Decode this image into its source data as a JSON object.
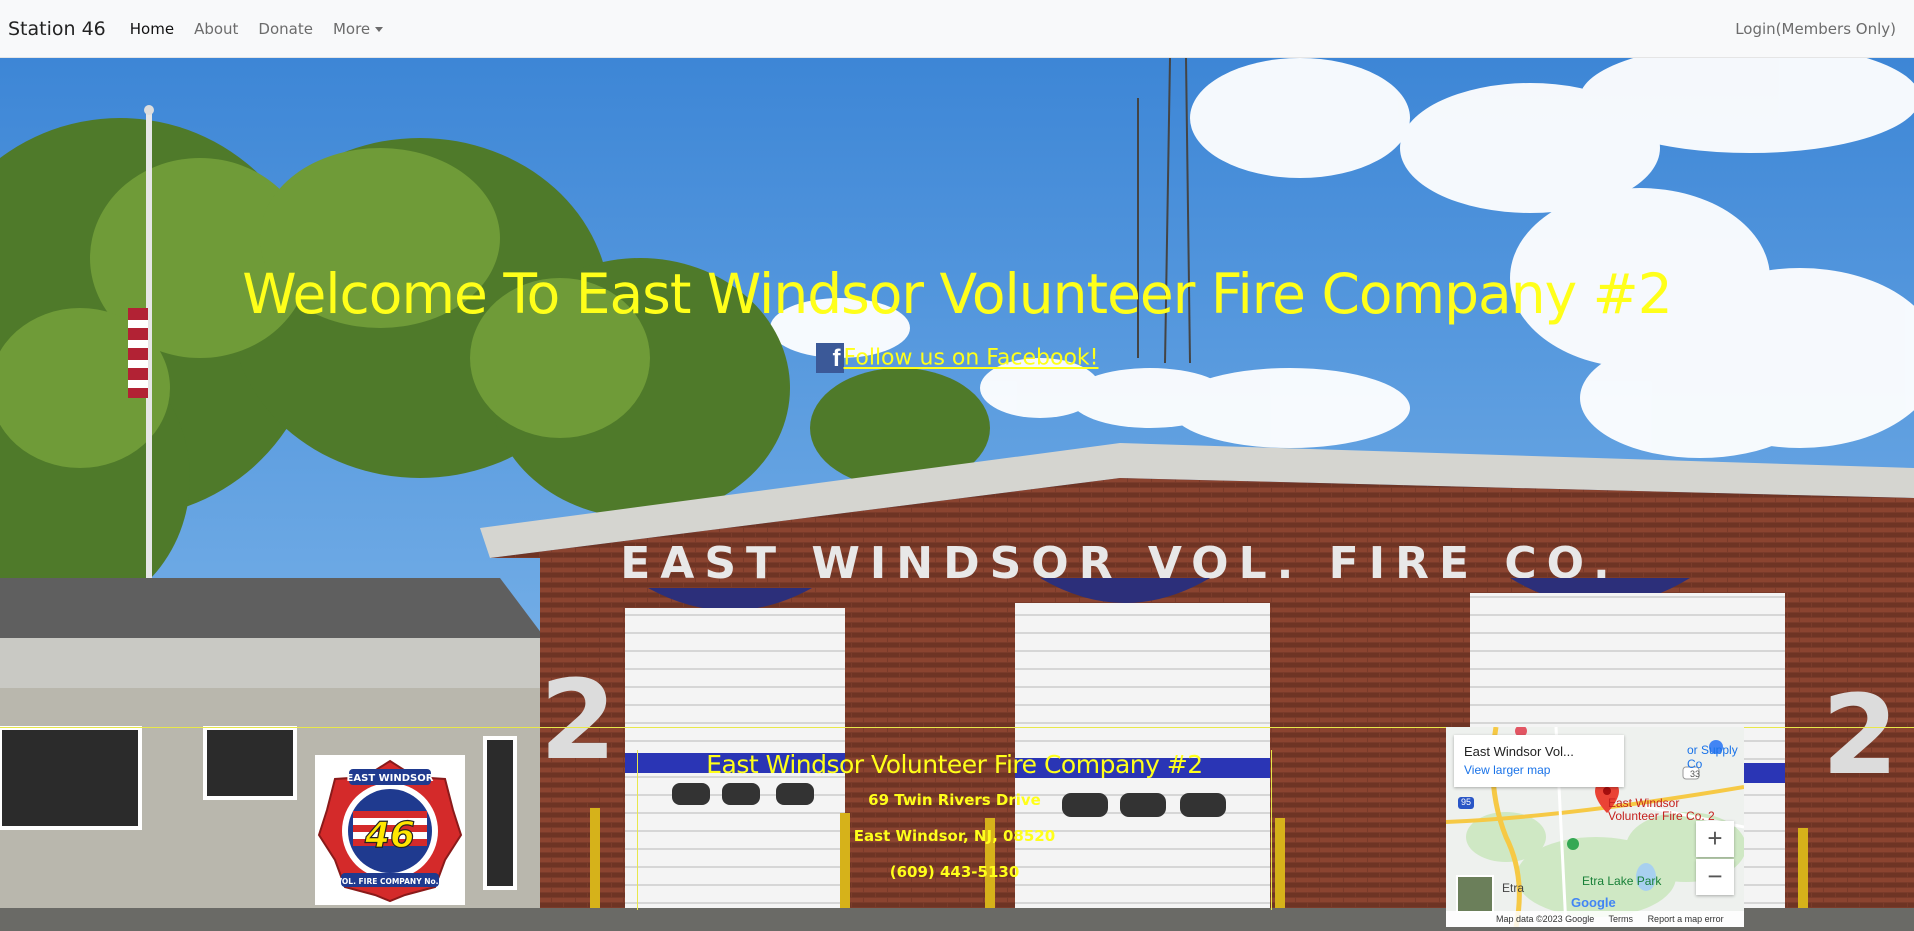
{
  "nav": {
    "brand": "Station 46",
    "links": [
      "Home",
      "About",
      "Donate",
      "More"
    ],
    "login": "Login(Members Only)"
  },
  "hero": {
    "welcome": "Welcome To East Windsor Volunteer Fire Company #2",
    "facebook_link": "Follow us on Facebook!",
    "facebook_icon": "facebook-icon",
    "building_sign": "EAST WINDSOR VOL. FIRE CO.",
    "building_number": "2"
  },
  "footer": {
    "title": "East Windsor Volunteer Fire Company #2",
    "address": "69 Twin Rivers Drive",
    "city": "East Windsor, NJ, 08520",
    "phone": "(609) 443-5130",
    "logo_text_top": "EAST WINDSOR",
    "logo_number": "46",
    "logo_text_bottom": "VOL. FIRE COMPANY No.2"
  },
  "map": {
    "place_title": "East Windsor Vol...",
    "view_larger": "View larger map",
    "marker_label_1": "East Windsor",
    "marker_label_2": "Volunteer Fire Co. 2",
    "poi_supply": "or Supply Co",
    "poi_park": "Etra Lake Park",
    "poi_etra": "Etra",
    "route_33": "33",
    "route_95": "95",
    "zoom_in": "+",
    "zoom_out": "−",
    "google": "Google",
    "footer_items": [
      "Map data ©2023 Google",
      "Terms",
      "Report a map error"
    ]
  },
  "colors": {
    "accent_yellow": "#ffff1a",
    "facebook_blue": "#3b5998",
    "map_link": "#1a73e8",
    "marker_red": "#ea4335"
  }
}
